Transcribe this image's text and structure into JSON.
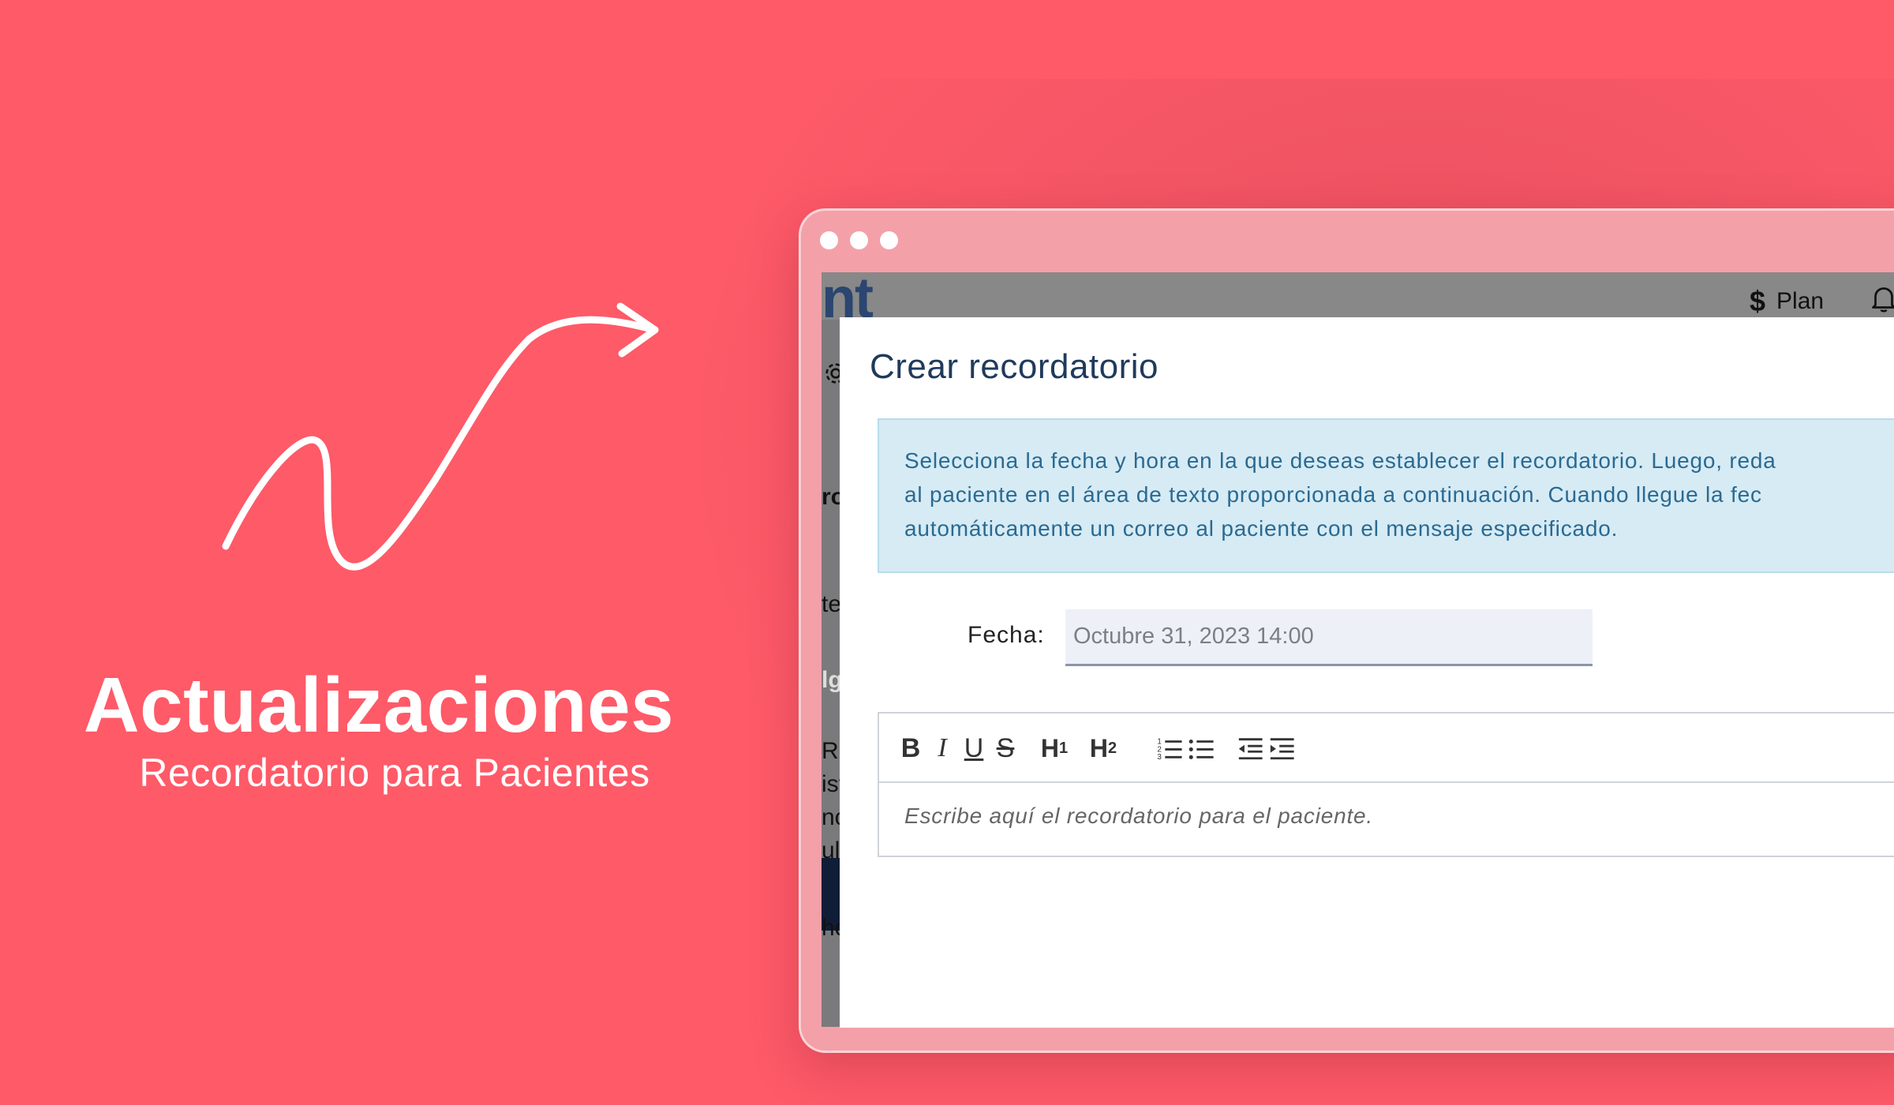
{
  "hero": {
    "title": "Actualizaciones",
    "subtitle": "Recordatorio para Pacientes"
  },
  "colors": {
    "background": "#fe5a68",
    "window_frame": "#f4a0a8",
    "alert_bg": "#d6ebf4",
    "alert_text": "#2a6a92",
    "modal_title": "#1f3a5c"
  },
  "app": {
    "logo_fragment": "nt",
    "topbar": {
      "plan_icon": "dollar-icon",
      "plan_label": "Plan",
      "bell_icon": "bell-icon"
    },
    "background_fragments": [
      "ro",
      "te",
      "lg",
      "RU",
      "ist",
      "nc",
      "ul",
      "ho"
    ]
  },
  "modal": {
    "title": "Crear recordatorio",
    "alert_lines": [
      "Selecciona la fecha y hora en la que deseas establecer el recordatorio. Luego, reda",
      "al paciente en el área de texto proporcionada a continuación. Cuando llegue la fec",
      "automáticamente un correo al paciente con el mensaje especificado."
    ],
    "fecha_label": "Fecha:",
    "fecha_value": "Octubre 31, 2023 14:00",
    "editor": {
      "toolbar": {
        "bold": "B",
        "italic": "I",
        "underline": "U",
        "strike": "S",
        "h1": "H",
        "h1_sub": "1",
        "h2": "H",
        "h2_sub": "2",
        "ordered_list_icon": "ordered-list-icon",
        "bullet_list_icon": "bullet-list-icon",
        "outdent_icon": "outdent-icon",
        "indent_icon": "indent-icon"
      },
      "placeholder": "Escribe aquí el recordatorio para el paciente."
    }
  }
}
